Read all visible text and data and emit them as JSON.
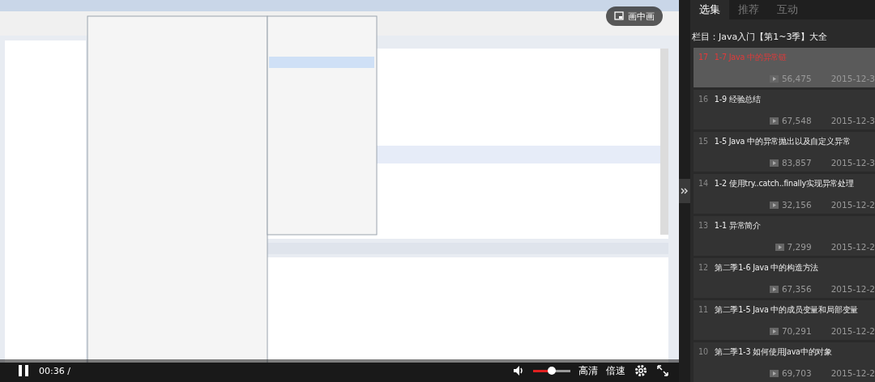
{
  "player": {
    "pip_label": "画中画",
    "time": "00:36 /",
    "volume": {
      "level": 0.5
    },
    "quality": "高清",
    "speed": "倍速"
  },
  "tabs": [
    {
      "label": "选集",
      "selected": true
    },
    {
      "label": "推荐",
      "selected": false
    },
    {
      "label": "互动",
      "selected": false
    }
  ],
  "column_title": "栏目：Java入门【第1~3季】大全",
  "episodes": [
    {
      "number": "17",
      "title": "1-7 Java 中的异常链",
      "plays": "56,475",
      "date": "2015-12-3",
      "selected": true
    },
    {
      "number": "16",
      "title": "1-9 经验总结",
      "plays": "67,548",
      "date": "2015-12-3",
      "selected": false
    },
    {
      "number": "15",
      "title": "1-5 Java 中的异常抛出以及自定义异常",
      "plays": "83,857",
      "date": "2015-12-3",
      "selected": false
    },
    {
      "number": "14",
      "title": "1-2 使用try..catch..finally实现异常处理",
      "plays": "32,156",
      "date": "2015-12-2",
      "selected": false
    },
    {
      "number": "13",
      "title": "1-1 异常简介",
      "plays": "7,299",
      "date": "2015-12-2",
      "selected": false
    },
    {
      "number": "12",
      "title": "第二季1-6 Java 中的构造方法",
      "plays": "67,356",
      "date": "2015-12-2",
      "selected": false
    },
    {
      "number": "11",
      "title": "第二季1-5 Java 中的成员变量和局部变量",
      "plays": "70,291",
      "date": "2015-12-2",
      "selected": false
    },
    {
      "number": "10",
      "title": "第二季1-3 如何使用Java中的对象",
      "plays": "69,703",
      "date": "2015-12-2",
      "selected": false
    }
  ]
}
